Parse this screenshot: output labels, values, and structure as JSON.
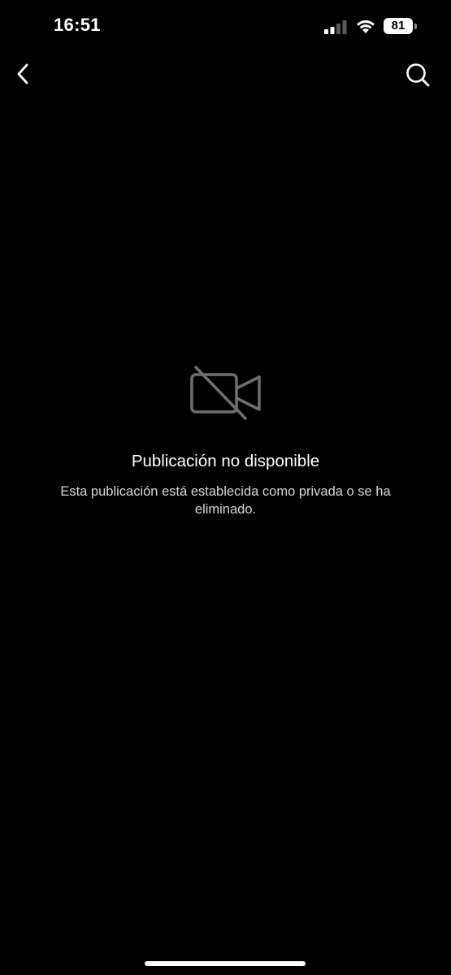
{
  "status_bar": {
    "time": "16:51",
    "battery_level": "81",
    "signal_bars_active": 2,
    "signal_bars_total": 4
  },
  "nav": {
    "back_icon": "chevron-left-icon",
    "search_icon": "search-icon"
  },
  "content": {
    "icon": "video-off-icon",
    "title": "Publicación no disponible",
    "message": "Esta publicación está establecida como privada o se ha eliminado."
  },
  "colors": {
    "background": "#000000",
    "text_primary": "#ffffff",
    "text_secondary": "#d6d6d6",
    "icon_muted": "#6f6f6f"
  }
}
